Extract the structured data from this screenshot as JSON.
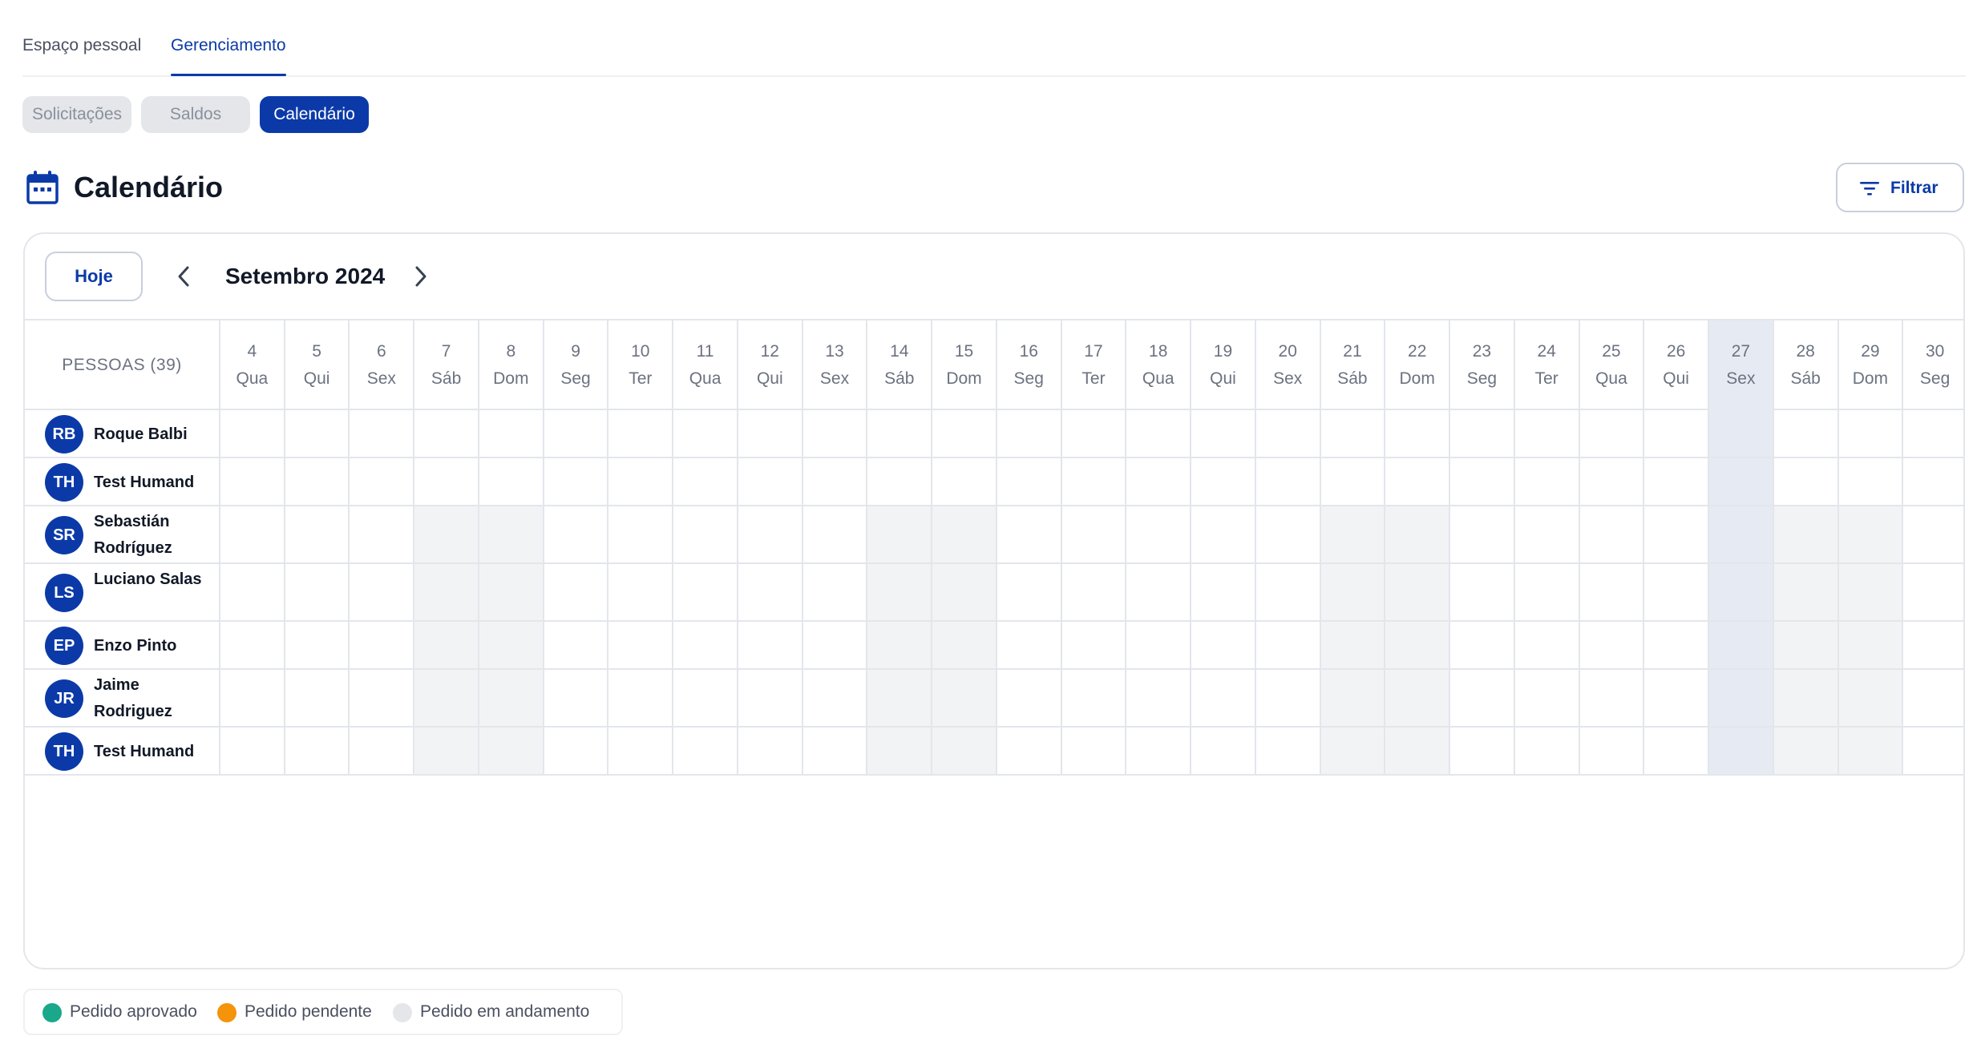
{
  "top_tabs": [
    {
      "label": "Espaço pessoal",
      "active": false
    },
    {
      "label": "Gerenciamento",
      "active": true
    }
  ],
  "sub_tabs": [
    {
      "label": "Solicitações",
      "active": false
    },
    {
      "label": "Saldos",
      "active": false
    },
    {
      "label": "Calendário",
      "active": true
    }
  ],
  "header": {
    "title": "Calendário",
    "icon": "calendar-icon",
    "filter_label": "Filtrar",
    "filter_icon": "filter-lines-icon"
  },
  "calendar": {
    "today_button": "Hoje",
    "month_label": "Setembro 2024",
    "prev_icon": "chevron-left-icon",
    "next_icon": "chevron-right-icon",
    "people_header": "PESSOAS (39)",
    "today_day": "27",
    "days": [
      {
        "num": "4",
        "wd": "Qua",
        "weekend": false
      },
      {
        "num": "5",
        "wd": "Qui",
        "weekend": false
      },
      {
        "num": "6",
        "wd": "Sex",
        "weekend": false
      },
      {
        "num": "7",
        "wd": "Sáb",
        "weekend": true
      },
      {
        "num": "8",
        "wd": "Dom",
        "weekend": true
      },
      {
        "num": "9",
        "wd": "Seg",
        "weekend": false
      },
      {
        "num": "10",
        "wd": "Ter",
        "weekend": false
      },
      {
        "num": "11",
        "wd": "Qua",
        "weekend": false
      },
      {
        "num": "12",
        "wd": "Qui",
        "weekend": false
      },
      {
        "num": "13",
        "wd": "Sex",
        "weekend": false
      },
      {
        "num": "14",
        "wd": "Sáb",
        "weekend": true
      },
      {
        "num": "15",
        "wd": "Dom",
        "weekend": true
      },
      {
        "num": "16",
        "wd": "Seg",
        "weekend": false
      },
      {
        "num": "17",
        "wd": "Ter",
        "weekend": false
      },
      {
        "num": "18",
        "wd": "Qua",
        "weekend": false
      },
      {
        "num": "19",
        "wd": "Qui",
        "weekend": false
      },
      {
        "num": "20",
        "wd": "Sex",
        "weekend": false
      },
      {
        "num": "21",
        "wd": "Sáb",
        "weekend": true
      },
      {
        "num": "22",
        "wd": "Dom",
        "weekend": true
      },
      {
        "num": "23",
        "wd": "Seg",
        "weekend": false
      },
      {
        "num": "24",
        "wd": "Ter",
        "weekend": false
      },
      {
        "num": "25",
        "wd": "Qua",
        "weekend": false
      },
      {
        "num": "26",
        "wd": "Qui",
        "weekend": false
      },
      {
        "num": "27",
        "wd": "Sex",
        "weekend": false
      },
      {
        "num": "28",
        "wd": "Sáb",
        "weekend": true
      },
      {
        "num": "29",
        "wd": "Dom",
        "weekend": true
      },
      {
        "num": "30",
        "wd": "Seg",
        "weekend": false
      }
    ],
    "people": [
      {
        "initials": "RB",
        "name": "Roque Balbi",
        "shade_weekends": false
      },
      {
        "initials": "TH",
        "name": "Test Humand",
        "shade_weekends": false
      },
      {
        "initials": "SR",
        "name": "Sebastián Rodríguez",
        "shade_weekends": true
      },
      {
        "initials": "LS",
        "name": "Luciano Salas",
        "shade_weekends": true
      },
      {
        "initials": "EP",
        "name": "Enzo Pinto",
        "shade_weekends": true
      },
      {
        "initials": "JR",
        "name": "Jaime Rodriguez",
        "shade_weekends": true
      },
      {
        "initials": "TH",
        "name": "Test Humand",
        "shade_weekends": true
      }
    ]
  },
  "legend": [
    {
      "label": "Pedido aprovado",
      "color": "#1aa88a"
    },
    {
      "label": "Pedido pendente",
      "color": "#f5930a"
    },
    {
      "label": "Pedido em andamento",
      "color": "#e4e6ea"
    }
  ],
  "colors": {
    "primary": "#0b3aa8",
    "today_column": "#e6eaf2",
    "weekend_cell": "#f2f3f5"
  }
}
